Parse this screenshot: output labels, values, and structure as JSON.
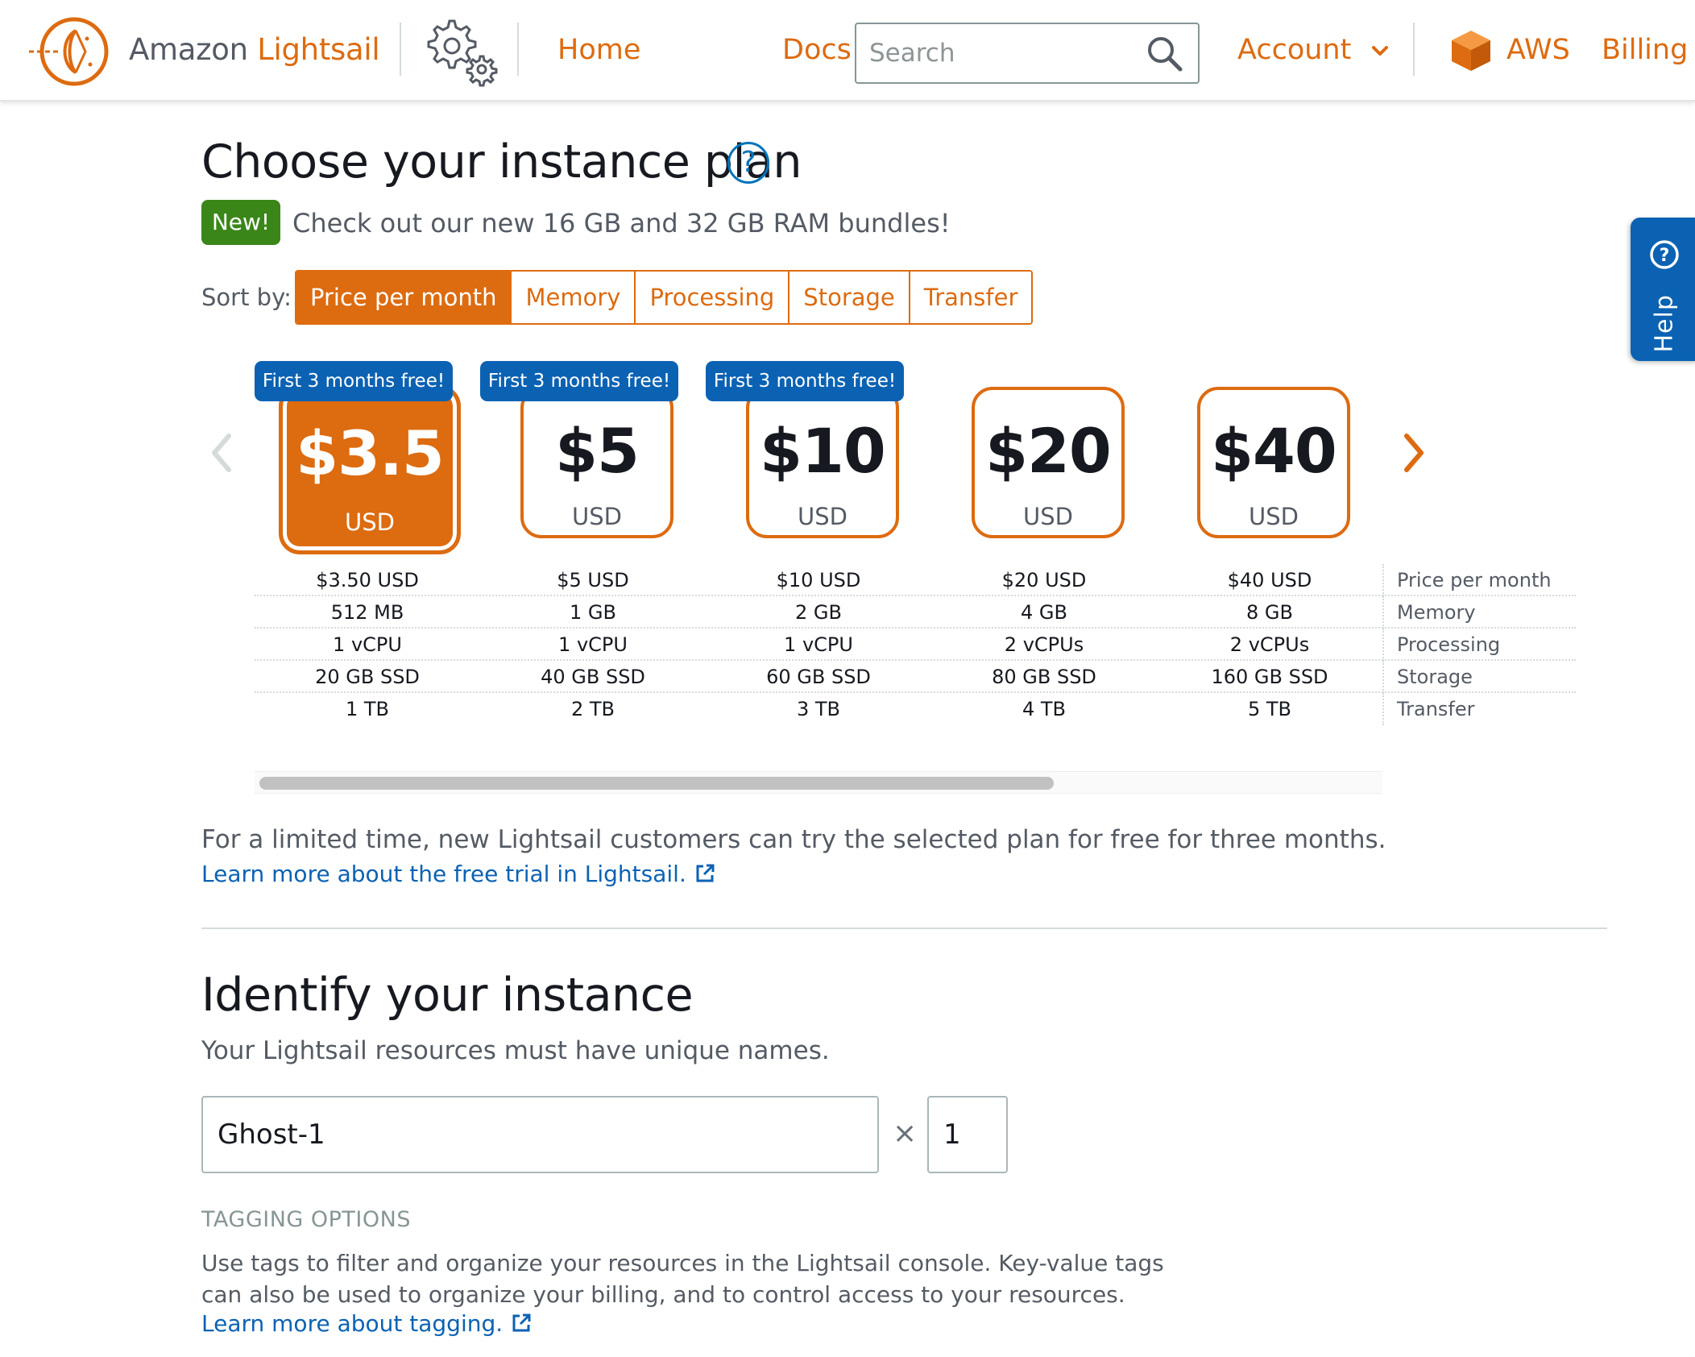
{
  "header": {
    "brand_prefix": "Amazon ",
    "brand_accent": "Lightsail",
    "home": "Home",
    "docs": "Docs",
    "search_placeholder": "Search",
    "account": "Account",
    "aws": "AWS",
    "billing": "Billing"
  },
  "plan_section": {
    "title": "Choose your instance plan",
    "help_symbol": "?",
    "new_badge": "New!",
    "new_text": "Check out our new 16 GB and 32 GB RAM bundles!",
    "sort_label": "Sort by:",
    "sort_options": [
      "Price per month",
      "Memory",
      "Processing",
      "Storage",
      "Transfer"
    ],
    "sort_selected": "Price per month",
    "plans": [
      {
        "price": "$3.5",
        "currency": "USD",
        "ribbon": "First 3 months free!",
        "selected": true,
        "price_per_month": "$3.50 USD",
        "memory": "512 MB",
        "processing": "1 vCPU",
        "storage": "20 GB SSD",
        "transfer": "1 TB"
      },
      {
        "price": "$5",
        "currency": "USD",
        "ribbon": "First 3 months free!",
        "selected": false,
        "price_per_month": "$5 USD",
        "memory": "1 GB",
        "processing": "1 vCPU",
        "storage": "40 GB SSD",
        "transfer": "2 TB"
      },
      {
        "price": "$10",
        "currency": "USD",
        "ribbon": "First 3 months free!",
        "selected": false,
        "price_per_month": "$10 USD",
        "memory": "2 GB",
        "processing": "1 vCPU",
        "storage": "60 GB SSD",
        "transfer": "3 TB"
      },
      {
        "price": "$20",
        "currency": "USD",
        "ribbon": "",
        "selected": false,
        "price_per_month": "$20 USD",
        "memory": "4 GB",
        "processing": "2 vCPUs",
        "storage": "80 GB SSD",
        "transfer": "4 TB"
      },
      {
        "price": "$40",
        "currency": "USD",
        "ribbon": "",
        "selected": false,
        "price_per_month": "$40 USD",
        "memory": "8 GB",
        "processing": "2 vCPUs",
        "storage": "160 GB SSD",
        "transfer": "5 TB"
      }
    ],
    "spec_labels": [
      "Price per month",
      "Memory",
      "Processing",
      "Storage",
      "Transfer"
    ],
    "free_trial_text": "For a limited time, new Lightsail customers can try the selected plan for free for three months.",
    "free_trial_link": "Learn more about the free trial in Lightsail."
  },
  "identify_section": {
    "title": "Identify your instance",
    "subtitle": "Your Lightsail resources must have unique names.",
    "name_value": "Ghost-1",
    "times_symbol": "×",
    "quantity_value": "1",
    "tagging_heading": "TAGGING OPTIONS",
    "tagging_desc": "Use tags to filter and organize your resources in the Lightsail console. Key-value tags can also be used to organize your billing, and to control access to your resources.",
    "tagging_link": "Learn more about tagging."
  },
  "help_tab": {
    "label": "Help",
    "symbol": "?"
  },
  "colors": {
    "accent": "#dd6b10",
    "link": "#0b62b3",
    "new_badge": "#3a8618",
    "help_tab": "#0b62b3"
  }
}
